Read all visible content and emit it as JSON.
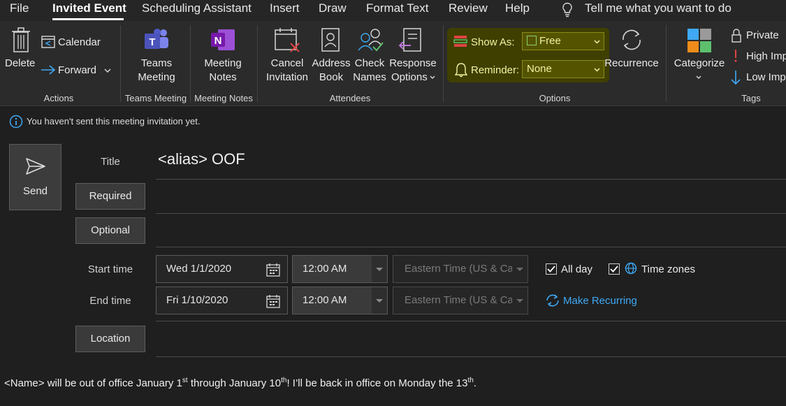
{
  "menu": {
    "tabs": [
      "File",
      "Invited Event",
      "Scheduling Assistant",
      "Insert",
      "Draw",
      "Format Text",
      "Review",
      "Help"
    ],
    "tell_me": "Tell me what you want to do"
  },
  "ribbon": {
    "actions": {
      "delete": "Delete",
      "calendar": "Calendar",
      "forward": "Forward",
      "group": "Actions"
    },
    "teams": {
      "line1": "Teams",
      "line2": "Meeting",
      "group": "Teams Meeting"
    },
    "notes": {
      "line1": "Meeting",
      "line2": "Notes",
      "group": "Meeting Notes"
    },
    "attendees": {
      "cancel1": "Cancel",
      "cancel2": "Invitation",
      "address1": "Address",
      "address2": "Book",
      "check1": "Check",
      "check2": "Names",
      "response1": "Response",
      "response2": "Options",
      "group": "Attendees"
    },
    "options": {
      "show_as_label": "Show As:",
      "show_as_value": "Free",
      "reminder_label": "Reminder:",
      "reminder_value": "None",
      "recurrence": "Recurrence",
      "group": "Options"
    },
    "tags": {
      "categorize": "Categorize",
      "private": "Private",
      "high": "High Imp",
      "low": "Low Imp",
      "group": "Tags"
    }
  },
  "info_message": "You haven't sent this meeting invitation yet.",
  "form": {
    "send": "Send",
    "title_label": "Title",
    "title_value": "<alias> OOF",
    "required": "Required",
    "optional": "Optional",
    "start_label": "Start time",
    "start_date": "Wed 1/1/2020",
    "start_time": "12:00 AM",
    "end_label": "End time",
    "end_date": "Fri 1/10/2020",
    "end_time": "12:00 AM",
    "timezone": "Eastern Time (US & Canada)",
    "all_day": "All day",
    "time_zones": "Time zones",
    "make_recurring": "Make Recurring",
    "location": "Location"
  },
  "body": {
    "part1": "<Name> will be out of office January 1",
    "sup1": "st",
    "part2": " through January 10",
    "sup2": "th",
    "part3": "! I’ll be back in office on Monday the 13",
    "sup3": "th",
    "part4": "."
  },
  "colors": {
    "accent_link": "#3fa9f5",
    "highlight": "#545400",
    "background": "#1f1f1f"
  }
}
